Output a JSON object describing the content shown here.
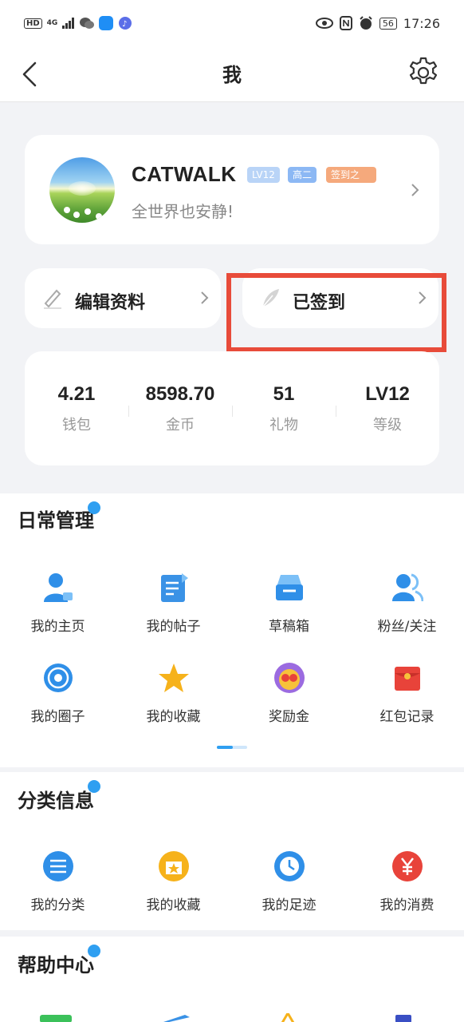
{
  "status_bar": {
    "network_badge": "HD",
    "signal": "4G",
    "battery": "56",
    "time": "17:26"
  },
  "nav": {
    "title": "我"
  },
  "profile": {
    "name": "CATWALK",
    "level_tag": "LV12",
    "grade_tag": "高二",
    "sign_tag": "签到之",
    "motto": "全世界也安静!"
  },
  "actions": {
    "edit_label": "编辑资料",
    "signed_label": "已签到"
  },
  "stats": [
    {
      "value": "4.21",
      "label": "钱包"
    },
    {
      "value": "8598.70",
      "label": "金币"
    },
    {
      "value": "51",
      "label": "礼物"
    },
    {
      "value": "LV12",
      "label": "等级"
    }
  ],
  "daily": {
    "title": "日常管理",
    "items": [
      {
        "label": "我的主页",
        "icon": "user-profile-icon"
      },
      {
        "label": "我的帖子",
        "icon": "post-icon"
      },
      {
        "label": "草稿箱",
        "icon": "drafts-icon"
      },
      {
        "label": "粉丝/关注",
        "icon": "followers-icon"
      },
      {
        "label": "我的圈子",
        "icon": "circle-icon"
      },
      {
        "label": "我的收藏",
        "icon": "star-icon"
      },
      {
        "label": "奖励金",
        "icon": "reward-icon"
      },
      {
        "label": "红包记录",
        "icon": "red-packet-icon"
      }
    ]
  },
  "category": {
    "title": "分类信息",
    "items": [
      {
        "label": "我的分类",
        "icon": "list-icon"
      },
      {
        "label": "我的收藏",
        "icon": "favorites-icon"
      },
      {
        "label": "我的足迹",
        "icon": "clock-icon"
      },
      {
        "label": "我的消费",
        "icon": "yen-icon"
      }
    ]
  },
  "help": {
    "title": "帮助中心"
  },
  "colors": {
    "accent": "#2f9ff1",
    "highlight": "#e84b3a",
    "background": "#f2f3f6"
  }
}
